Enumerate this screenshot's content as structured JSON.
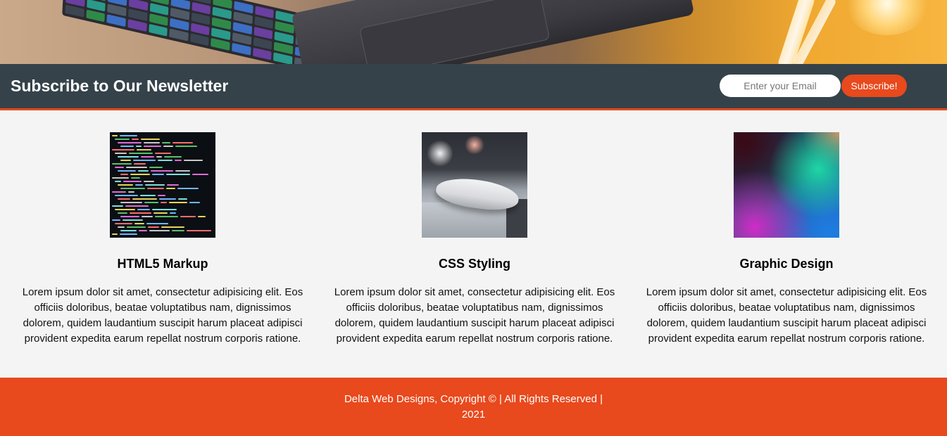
{
  "newsletter": {
    "title": "Subscribe to Our Newsletter",
    "email_placeholder": "Enter your Email",
    "subscribe_label": "Subscribe!"
  },
  "features": [
    {
      "heading": "HTML5 Markup",
      "image": "code-screenshot-image",
      "text": "Lorem ipsum dolor sit amet, consectetur adipisicing elit. Eos officiis doloribus, beatae voluptatibus nam, dignissimos dolorem, quidem laudantium suscipit harum placeat adipisci provident expedita earum repellat nostrum corporis ratione."
    },
    {
      "heading": "CSS Styling",
      "image": "computer-mouse-image",
      "text": "Lorem ipsum dolor sit amet, consectetur adipisicing elit. Eos officiis doloribus, beatae voluptatibus nam, dignissimos dolorem, quidem laudantium suscipit harum placeat adipisci provident expedita earum repellat nostrum corporis ratione."
    },
    {
      "heading": "Graphic Design",
      "image": "abstract-gradient-image",
      "text": "Lorem ipsum dolor sit amet, consectetur adipisicing elit. Eos officiis doloribus, beatae voluptatibus nam, dignissimos dolorem, quidem laudantium suscipit harum placeat adipisci provident expedita earum repellat nostrum corporis ratione."
    }
  ],
  "footer": {
    "text": "Delta Web Designs, Copyright © | All Rights Reserved | 2021"
  },
  "colors": {
    "accent": "#e8491d",
    "dark_bar": "#35424a",
    "background": "#f4f4f4"
  }
}
